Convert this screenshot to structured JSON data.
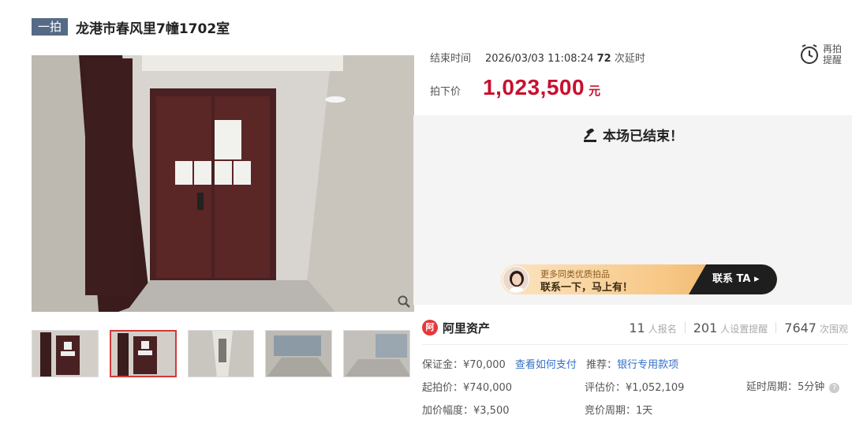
{
  "header": {
    "tag": "一拍",
    "title": "龙港市春风里7幢1702室"
  },
  "auction": {
    "end_label": "结束时间",
    "end_time": "2026/03/03 11:08:24",
    "delay_count": "72",
    "delay_label": "次延时",
    "remind_line1": "再拍",
    "remind_line2": "提醒",
    "price_label": "拍下价",
    "price_value": "1,023,500",
    "price_unit": "元",
    "ended_text": "本场已结束！"
  },
  "banner": {
    "line1": "更多同类优质拍品",
    "line2": "联系一下，马上有！",
    "cta": "联系 TA ▸"
  },
  "provider": {
    "name": "阿里资产",
    "registered_count": "11",
    "registered_label": "人报名",
    "reminder_count": "201",
    "reminder_label": "人设置提醒",
    "view_count": "7647",
    "view_label": "次围观"
  },
  "details": {
    "deposit": "保证金：¥70,000",
    "pay_link": "查看如何支付",
    "recommend_label": "推荐：",
    "recommend_link": "银行专用款项",
    "start_price": "起拍价：¥740,000",
    "valuation": "评估价：¥1,052,109",
    "delay_period": "延时周期：5分钟",
    "increment": "加价幅度：¥3,500",
    "bid_period": "竞价周期：1天"
  },
  "colors": {
    "price": "#c8102e",
    "tag_bg": "#556b85",
    "link": "#3370c9",
    "active_thumb": "#d23a3a"
  }
}
